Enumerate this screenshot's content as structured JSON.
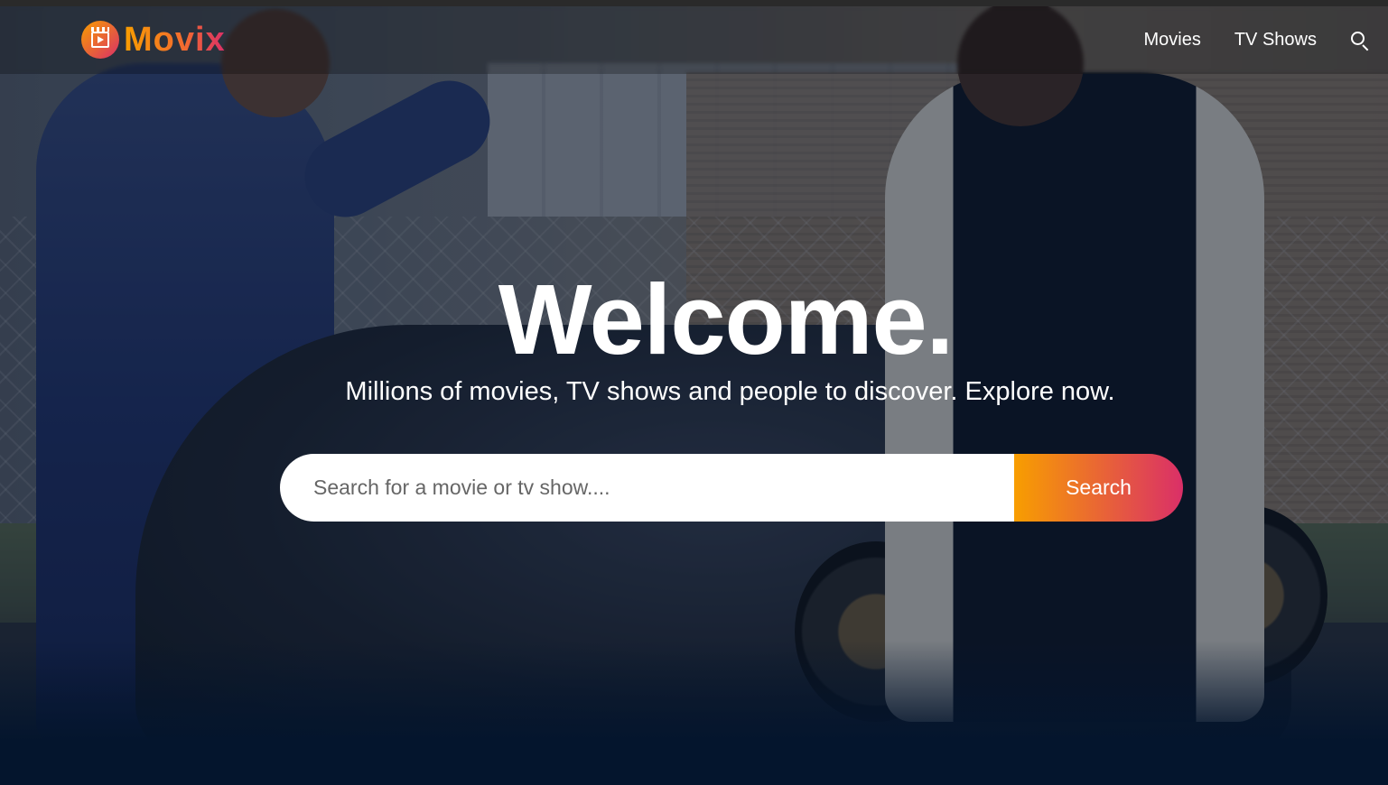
{
  "header": {
    "logo_text": "Movix",
    "nav": {
      "movies_label": "Movies",
      "tv_shows_label": "TV Shows"
    }
  },
  "hero": {
    "title": "Welcome.",
    "subtitle": "Millions of movies, TV shows and people to discover. Explore now.",
    "search": {
      "placeholder": "Search for a movie or tv show....",
      "value": "",
      "button_label": "Search"
    }
  },
  "icons": {
    "logo": "clapperboard-play-icon",
    "nav_search": "search-icon"
  },
  "colors": {
    "brand_gradient_start": "#f89e00",
    "brand_gradient_end": "#da2f68",
    "page_background": "#04152d",
    "text": "#ffffff"
  }
}
